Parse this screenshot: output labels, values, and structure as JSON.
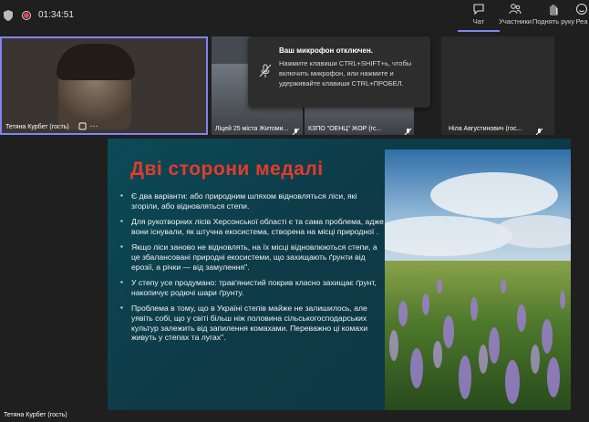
{
  "topbar": {
    "timer": "01:34:51",
    "tools": [
      {
        "label": "Чат",
        "icon": "chat-icon"
      },
      {
        "label": "Участники",
        "icon": "people-icon"
      },
      {
        "label": "Поднять руку",
        "icon": "raise-hand-icon"
      },
      {
        "label": "Реа",
        "icon": "reactions-icon"
      }
    ]
  },
  "videos": [
    {
      "name": "Тетяна Курбет (гость)"
    },
    {
      "name": "Ліцей 25 міста Житоми..."
    },
    {
      "name": "КЗПО \"ОЕНЦ\" ЖОР (гс..."
    },
    {
      "name": "Ніла Августинович (гос..."
    }
  ],
  "toast": {
    "title": "Ваш микрофон отключен.",
    "body": "Нажмите клавиши CTRL+SHIFT+ь, чтобы включить микрофон, или нажмите и удерживайте клавиши CTRL+ПРОБЕЛ."
  },
  "slide": {
    "title": "Дві сторони медалі",
    "bullets": [
      "Є два варіанти: або природним шляхом відновляться ліси, які згоріли, або відновляться степи.",
      "Для рукотворних лісів Херсонської області є та сама проблема, адже вони існували, як штучна екосистема, створена на місці природної .",
      "Якщо ліси заново не відновлять, на їх місці відновлюються степи, а це збалансовані природні екосистеми, що захищають ґрунти від ерозії, а річки — від замулення\".",
      "У степу усе продумано: трав'янистий покрив класно захищає ґрунт, накопичує родючі шари ґрунту.",
      "Проблема в тому, що в Україні степів майже не залишилось, але уявіть собі, що у світі більш ніж половина сільськогосподарських культур залежить від запилення комахами. Переважно ці комахи живуть у степах та лугах\"."
    ]
  },
  "presenter_label": "Тетяна Курбет (гость)"
}
